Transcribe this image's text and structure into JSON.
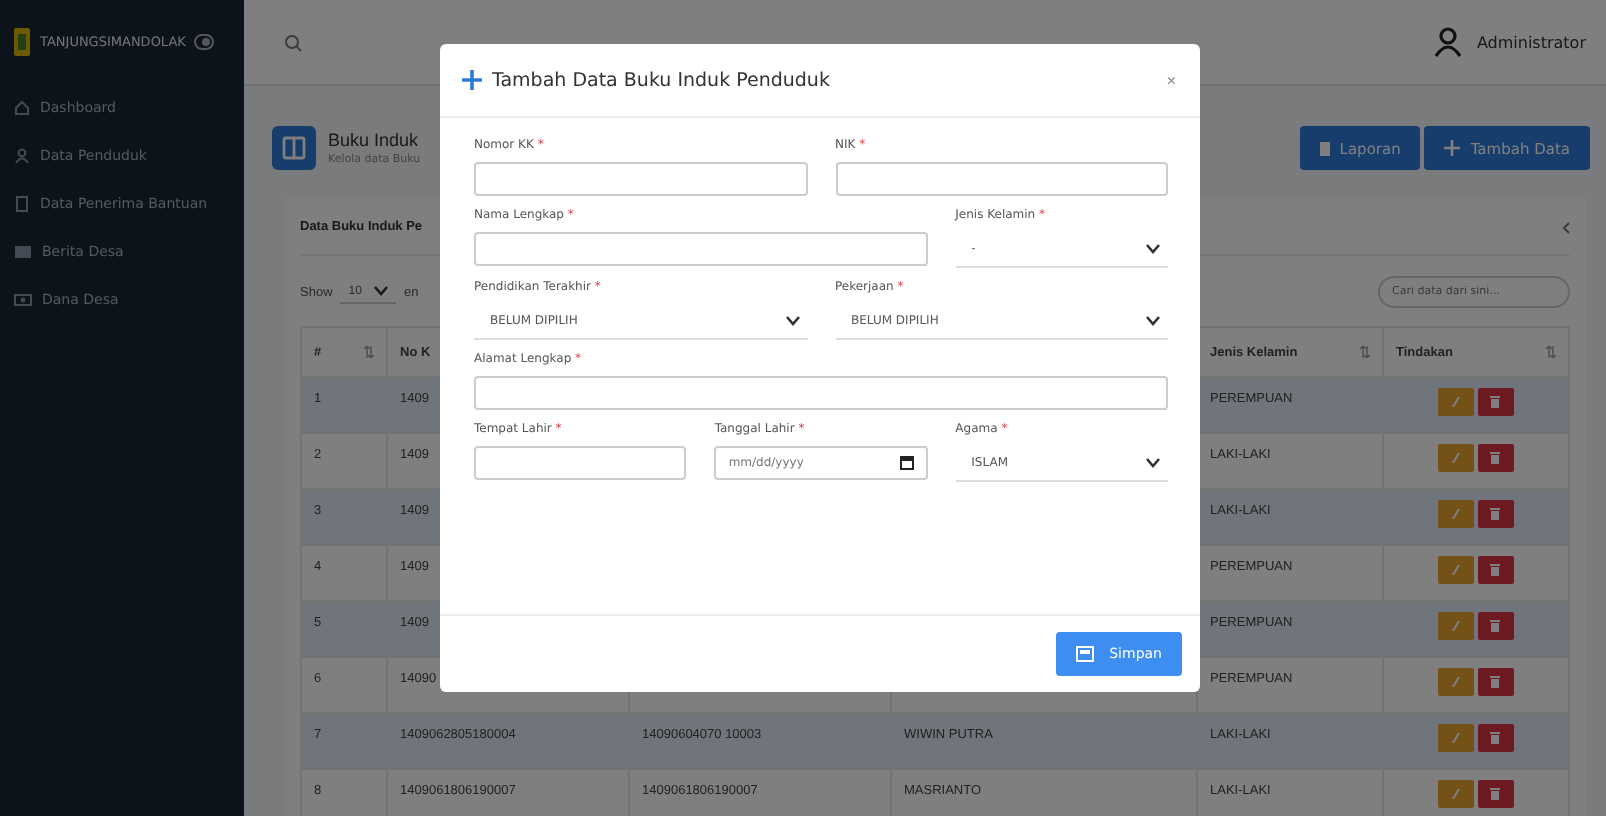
{
  "sidebar": {
    "brand": "TANJUNGSIMANDOLAK",
    "items": [
      {
        "label": "Dashboard",
        "kind": "home"
      },
      {
        "label": "Data Penduduk",
        "kind": "person"
      },
      {
        "label": "Data Penerima Bantuan",
        "kind": "doc"
      },
      {
        "label": "Berita Desa",
        "kind": "news"
      },
      {
        "label": "Dana Desa",
        "kind": "money"
      }
    ]
  },
  "topbar": {
    "user": "Administrator"
  },
  "page": {
    "title": "Buku Induk",
    "subtitle": "Kelola data Buku",
    "buttons": [
      {
        "label": "Laporan",
        "kind": "report"
      },
      {
        "label": "Tambah Data",
        "kind": "add"
      }
    ]
  },
  "card": {
    "title": "Data Buku Induk Pe",
    "show_label": "Show",
    "page_size": "10",
    "entries_label": "en",
    "search_placeholder": "Cari data dari sini...",
    "columns": [
      {
        "label": "#",
        "sortable": true
      },
      {
        "label": "No K"
      },
      {},
      {},
      {
        "label": "Jenis Kelamin",
        "sortable": true
      },
      {
        "label": "Tindakan",
        "sortable": true
      }
    ],
    "rows": [
      {
        "no": "1",
        "no_kk": "1409",
        "jenis_kelamin": "PEREMPUAN"
      },
      {
        "no": "2",
        "no_kk": "1409",
        "jenis_kelamin": "LAKI-LAKI"
      },
      {
        "no": "3",
        "no_kk": "1409",
        "jenis_kelamin": "LAKI-LAKI"
      },
      {
        "no": "4",
        "no_kk": "1409",
        "jenis_kelamin": "PEREMPUAN"
      },
      {
        "no": "5",
        "no_kk": "1409",
        "jenis_kelamin": "PEREMPUAN"
      },
      {
        "no": "6",
        "no_kk": "14090",
        "jenis_kelamin": "PEREMPUAN"
      },
      {
        "no": "7",
        "no_kk": "1409062805180004",
        "nik": "14090604070 10003",
        "nama": "WIWIN PUTRA",
        "jenis_kelamin": "LAKI-LAKI"
      },
      {
        "no": "8",
        "no_kk": "1409061806190007",
        "nik": "1409061806190007",
        "nama": "MASRIANTO",
        "jenis_kelamin": "LAKI-LAKI"
      }
    ]
  },
  "modal": {
    "title": "Tambah Data Buku Induk Penduduk",
    "close": "×",
    "submit": "Simpan",
    "fields": [
      {
        "label": "Nomor KK",
        "mark": "*",
        "kind": "text"
      },
      {
        "label": "NIK",
        "mark": "*",
        "kind": "text"
      },
      {
        "label": "Nama Lengkap",
        "mark": "*",
        "kind": "text"
      },
      {
        "label": "Jenis Kelamin",
        "mark": "*",
        "kind": "select",
        "value": "-"
      },
      {
        "label": "Pendidikan Terakhir",
        "mark": "*",
        "kind": "select",
        "value": "BELUM DIPILIH"
      },
      {
        "label": "Pekerjaan",
        "mark": "*",
        "kind": "select",
        "value": "BELUM DIPILIH"
      },
      {
        "label": "Alamat Lengkap",
        "mark": "*",
        "kind": "text"
      },
      {
        "label": "Tempat Lahir",
        "mark": "*",
        "kind": "text"
      },
      {
        "label": "Tanggal Lahir",
        "mark": "*",
        "kind": "date",
        "placeholder": "mm/dd/yyyy"
      },
      {
        "label": "Agama",
        "mark": "*",
        "kind": "select",
        "value": "ISLAM"
      }
    ]
  }
}
